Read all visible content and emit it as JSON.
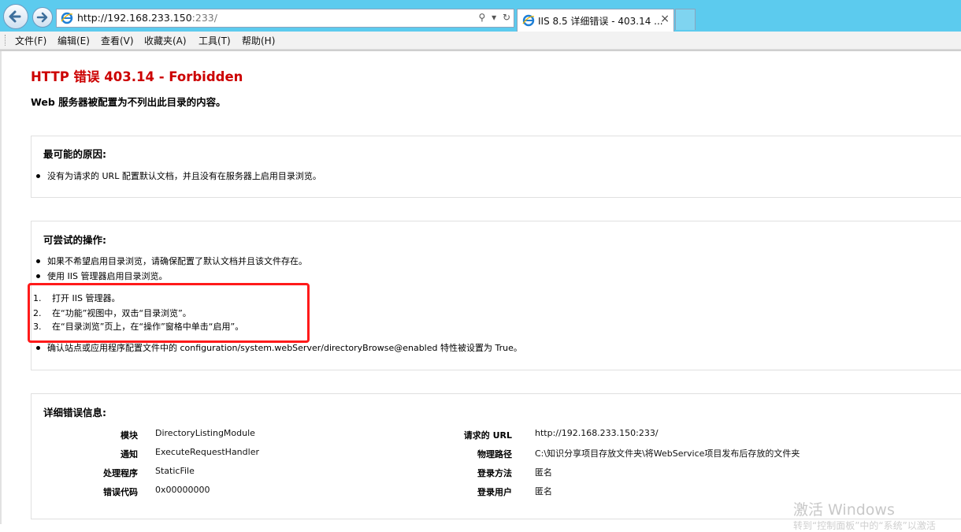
{
  "browser": {
    "url_host": "http://192.168.233.150",
    "url_port": ":233/",
    "tab_title": "IIS 8.5 详细错误 - 403.14 ...",
    "tab_close": "×",
    "addr_icons": [
      "search-icon",
      "dropdown-icon",
      "refresh-icon"
    ],
    "search_glyph": "⚲",
    "dropdown_glyph": "▾",
    "refresh_glyph": "↻"
  },
  "menu": [
    "文件(F)",
    "编辑(E)",
    "查看(V)",
    "收藏夹(A)",
    "工具(T)",
    "帮助(H)"
  ],
  "page": {
    "title": "HTTP 错误 403.14 - Forbidden",
    "subtitle": "Web 服务器被配置为不列出此目录的内容。",
    "causes": {
      "heading": "最可能的原因:",
      "items": [
        "没有为请求的 URL 配置默认文档，并且没有在服务器上启用目录浏览。"
      ]
    },
    "actions": {
      "heading": "可尝试的操作:",
      "items": [
        "如果不希望启用目录浏览，请确保配置了默认文档并且该文件存在。",
        "使用 IIS 管理器启用目录浏览。"
      ],
      "steps": [
        "打开 IIS 管理器。",
        "在“功能”视图中，双击“目录浏览”。",
        "在“目录浏览”页上，在“操作”窗格中单击“启用”。"
      ],
      "step_numbers": [
        "1.",
        "2.",
        "3."
      ],
      "last_item": "确认站点或应用程序配置文件中的 configuration/system.webServer/directoryBrowse@enabled 特性被设置为 True。"
    },
    "details": {
      "heading": "详细错误信息:",
      "left": [
        {
          "label": "模块",
          "value": "DirectoryListingModule"
        },
        {
          "label": "通知",
          "value": "ExecuteRequestHandler"
        },
        {
          "label": "处理程序",
          "value": "StaticFile"
        },
        {
          "label": "错误代码",
          "value": "0x00000000"
        }
      ],
      "right": [
        {
          "label": "请求的 URL",
          "value": "http://192.168.233.150:233/"
        },
        {
          "label": "物理路径",
          "value": "C:\\知识分享项目存放文件夹\\将WebService项目发布后存放的文件夹"
        },
        {
          "label": "登录方法",
          "value": "匿名"
        },
        {
          "label": "登录用户",
          "value": "匿名"
        }
      ]
    }
  },
  "watermark": {
    "line1": "激活 Windows",
    "line2": "转到“控制面板”中的“系统”以激活"
  },
  "colors": {
    "title_red": "#cc0000",
    "highlight_red": "#ff1a1a",
    "chrome_blue": "#5ccbee"
  }
}
